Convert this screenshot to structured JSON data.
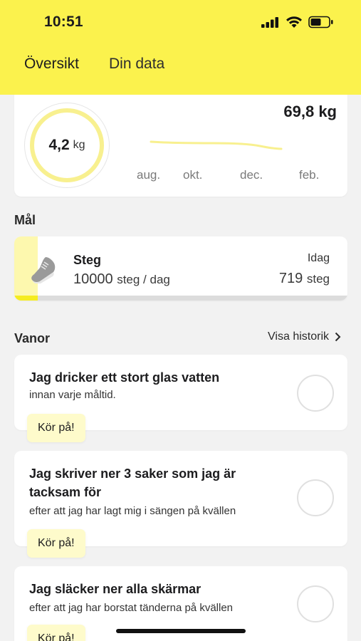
{
  "status": {
    "time": "10:51"
  },
  "tabs": [
    {
      "label": "Översikt"
    },
    {
      "label": "Din data"
    }
  ],
  "weight": {
    "lost_value": "4,2",
    "lost_unit": "kg",
    "current": "69,8 kg",
    "months": [
      "aug.",
      "okt.",
      "dec.",
      "feb."
    ]
  },
  "goals": {
    "section_title": "Mål",
    "item": {
      "name": "Steg",
      "target_value": "10000",
      "target_unit": "steg / dag",
      "today_label": "Idag",
      "today_value": "719",
      "today_unit": "steg",
      "progress_fraction": 0.072
    }
  },
  "habits": {
    "section_title": "Vanor",
    "history_link": "Visa historik",
    "items": [
      {
        "title": "Jag dricker ett stort glas vatten",
        "description": "innan varje måltid.",
        "badge": "Kör på!"
      },
      {
        "title_line1": "Jag skriver ner 3 saker som jag är",
        "title_line2": "tacksam för",
        "description": "efter att jag har lagt mig i sängen på kvällen",
        "badge": "Kör på!"
      },
      {
        "title": "Jag släcker ner alla skärmar",
        "description": "efter att jag har borstat tänderna på kvällen",
        "badge": "Kör på!"
      }
    ]
  },
  "colors": {
    "brand_yellow": "#fbf24d",
    "light_yellow": "#fefbcb"
  }
}
